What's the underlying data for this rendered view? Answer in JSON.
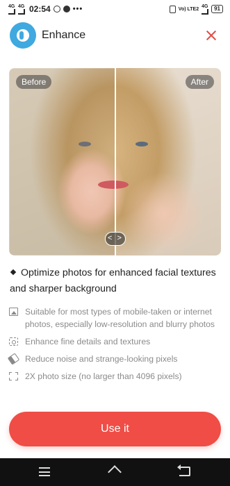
{
  "status_bar": {
    "sim1": "4G",
    "sim2": "4G",
    "time": "02:54",
    "network": "Vo) LTE2",
    "network_type": "4G",
    "battery": "91"
  },
  "header": {
    "title": "Enhance",
    "logo_icon": "enhance-app-icon",
    "close_icon": "close-icon",
    "accent_color": "#e24d48"
  },
  "compare": {
    "before_label": "Before",
    "after_label": "After",
    "handle_glyph": "< >"
  },
  "headline": "Optimize photos for enhanced facial textures and sharper background",
  "features": [
    {
      "icon": "image-icon",
      "text": "Suitable for most types of mobile-taken or internet photos, especially low-resolution and blurry photos"
    },
    {
      "icon": "focus-icon",
      "text": "Enhance fine details and textures"
    },
    {
      "icon": "eraser-icon",
      "text": "Reduce noise and strange-looking pixels"
    },
    {
      "icon": "expand-icon",
      "text": "2X photo size (no larger than 4096 pixels)"
    }
  ],
  "cta": {
    "label": "Use it",
    "color": "#ef4d46"
  },
  "navbar": {
    "menu_icon": "menu-icon",
    "home_icon": "home-icon",
    "back_icon": "back-icon"
  }
}
